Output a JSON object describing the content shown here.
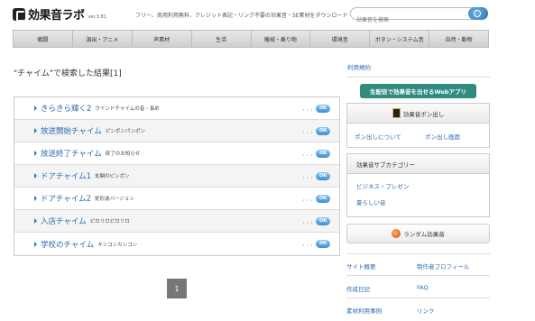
{
  "header": {
    "logo_text": "効果音ラボ",
    "version": "ver.3.81",
    "tagline": "フリー、商用利用無料、クレジット表記・リンク不要の効果音・SE素材をダウンロード",
    "search_placeholder": "効果音を検索"
  },
  "nav": [
    "戦闘",
    "演出・アニメ",
    "声素材",
    "生活",
    "機械・乗り物",
    "環境音",
    "ボタン・システム音",
    "自然・動物"
  ],
  "results_title": "\"チャイム\"で検索した結果[1]",
  "results": [
    {
      "title": "きらきら輝く2",
      "desc": "ウインドチャイムの音・長め"
    },
    {
      "title": "放送開始チャイム",
      "desc": "ピンポンパンポン"
    },
    {
      "title": "放送終了チャイム",
      "desc": "終了のお知らせ"
    },
    {
      "title": "ドアチャイム1",
      "desc": "玄関のピンポン"
    },
    {
      "title": "ドアチャイム2",
      "desc": "矩形波バージョン"
    },
    {
      "title": "入店チャイム",
      "desc": "ピロリロピロリロ"
    },
    {
      "title": "学校のチャイム",
      "desc": "キンコンカンコン"
    }
  ],
  "ok_label": "OK",
  "dots": "・・・",
  "pagination": {
    "current": "1"
  },
  "sidebar": {
    "terms": "利用規約",
    "app_button": "生配信で効果音を出せるWebアプリ",
    "pon_title": "効果音ポン出し",
    "pon_about": "ポン出しについて",
    "pon_screen": "ポン出し画面",
    "subcat_title": "効果音サブカテゴリー",
    "subcat_items": [
      "ビジネス・プレゼン",
      "夏らしい音"
    ],
    "random": "ランダム効果音",
    "footer_links": [
      "サイト概要",
      "制作者プロフィール",
      "作成日記",
      "FAQ",
      "素材利用事例",
      "リンク"
    ]
  },
  "colors": {
    "accent": "#2b6cb0",
    "app_button": "#2e8b7e",
    "pager": "#777777"
  }
}
